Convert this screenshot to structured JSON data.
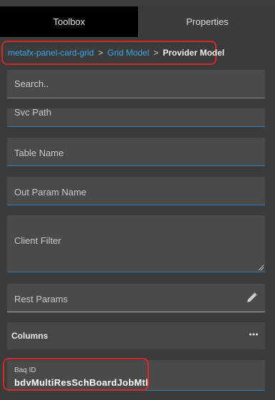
{
  "tabs": [
    {
      "label": "Toolbox"
    },
    {
      "label": "Properties"
    }
  ],
  "breadcrumb": {
    "items": [
      "metafx-panel-card-grid",
      "Grid Model"
    ],
    "separator": ">",
    "current": "Provider Model"
  },
  "fields": {
    "search": "Search..",
    "svc_path": "Svc Path",
    "table_name": "Table Name",
    "out_param_name": "Out Param Name",
    "client_filter": "Client Filter",
    "rest_params": "Rest Params",
    "columns": "Columns",
    "baq_label": "Baq ID",
    "baq_value": "bdvMultiResSchBoardJobMtl"
  },
  "icons": {
    "rest_params": "pencil-icon",
    "columns": "more-icon",
    "client_filter": "resize-grip-icon"
  },
  "colors": {
    "accent_link": "#3aa8e8",
    "highlight": "#d42a2a",
    "field_underline": "#2e7fb5"
  }
}
